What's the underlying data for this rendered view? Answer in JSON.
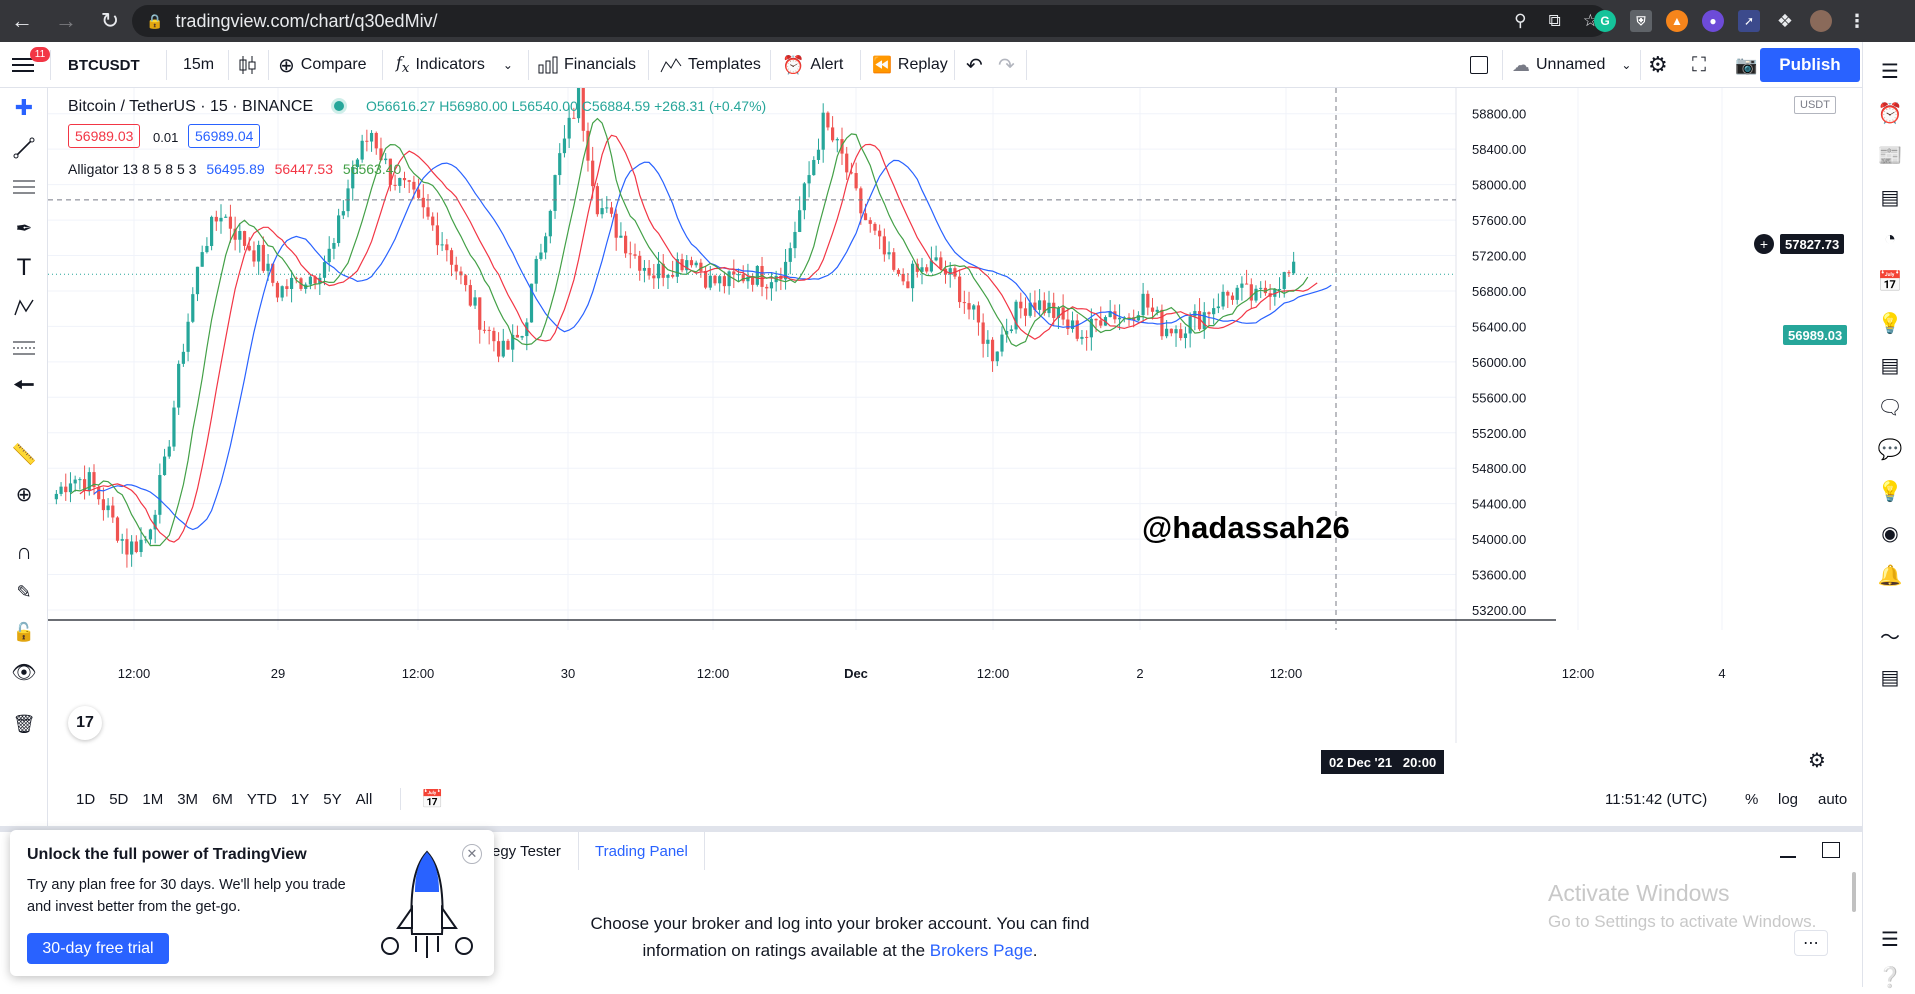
{
  "browser": {
    "url": "tradingview.com/chart/q30edMiv/"
  },
  "header": {
    "menu_badge": "11",
    "symbol": "BTCUSDT",
    "interval": "15m",
    "compare": "Compare",
    "indicators": "Indicators",
    "financials": "Financials",
    "templates": "Templates",
    "alert": "Alert",
    "replay": "Replay",
    "layout_name": "Unnamed",
    "publish": "Publish"
  },
  "legend": {
    "title": "Bitcoin / TetherUS · 15 · BINANCE",
    "ohlc": {
      "o": "56616.27",
      "h": "56980.00",
      "l": "56540.00",
      "c": "56884.59",
      "chg": "+268.31 (+0.47%)"
    },
    "sell": "56989.03",
    "spread": "0.01",
    "buy": "56989.04",
    "alligator_label": "Alligator 13 8 5 8 5 3",
    "alligator_values": [
      "56495.89",
      "56447.53",
      "56563.40"
    ]
  },
  "annotation": "@hadassah26",
  "axis": {
    "currency": "USDT",
    "crosshair_price": "57827.73",
    "last_price": "56989.03",
    "y_ticks": [
      "58800.00",
      "58400.00",
      "58000.00",
      "57600.00",
      "57200.00",
      "56800.00",
      "56400.00",
      "56000.00",
      "55600.00",
      "55200.00",
      "54800.00",
      "54400.00",
      "54000.00",
      "53600.00",
      "53200.00"
    ],
    "x_ticks": [
      "12:00",
      "29",
      "12:00",
      "30",
      "12:00",
      "Dec",
      "12:00",
      "2",
      "12:00",
      "12:00",
      "4"
    ],
    "crosshair_time": "02 Dec '21   20:00"
  },
  "bottom": {
    "ranges": [
      "1D",
      "5D",
      "1M",
      "3M",
      "6M",
      "YTD",
      "1Y",
      "5Y",
      "All"
    ],
    "clock": "11:51:42 (UTC)",
    "pct": "%",
    "log": "log",
    "auto": "auto"
  },
  "panel": {
    "tab_strategy": "egy Tester",
    "tab_trading": "Trading Panel",
    "msg_line1": "Choose your broker and log into your broker account. You can find",
    "msg_line2_pre": "information on ratings available at the ",
    "msg_link": "Brokers Page",
    "msg_end": "."
  },
  "promo": {
    "title": "Unlock the full power of TradingView",
    "body1": "Try any plan free for 30 days. We'll help you trade",
    "body2": "and invest better from the get-go.",
    "cta": "30-day free trial"
  },
  "watermark": {
    "line1": "Activate Windows",
    "line2": "Go to Settings to activate Windows."
  },
  "colors": {
    "up": "#26a69a",
    "down": "#ef5350",
    "jaw": "#2962ff",
    "teeth": "#f23645",
    "lips": "#43a047",
    "accent": "#2962ff"
  },
  "chart_data": {
    "type": "candlestick",
    "series": [
      {
        "name": "Bitcoin / TetherUS",
        "values": [
          54450,
          54700,
          54650,
          54300,
          53900,
          54000,
          54800,
          56200,
          57300,
          57700,
          57400,
          57200,
          56800,
          56900,
          57000,
          57300,
          58200,
          58600,
          58100,
          57900,
          57600,
          57300,
          56800,
          56400,
          56100,
          56300,
          57300,
          58300,
          59000,
          57800,
          57500,
          57200,
          57000,
          57100,
          57200,
          56900,
          56900,
          57000,
          56950,
          57100,
          57900,
          58700,
          58300,
          57700,
          57300,
          56900,
          57000,
          57100,
          56900,
          56500,
          56100,
          56500,
          56700,
          56600,
          56400,
          56300,
          56600,
          56500,
          56700,
          56400,
          56400,
          56500,
          56700,
          56800,
          56700,
          56900,
          57000
        ]
      },
      {
        "name": "Alligator 13 8 5 8 5 3",
        "values": [
          56495.89,
          56447.53,
          56563.4
        ]
      }
    ],
    "ylim": [
      53200,
      59000
    ]
  }
}
